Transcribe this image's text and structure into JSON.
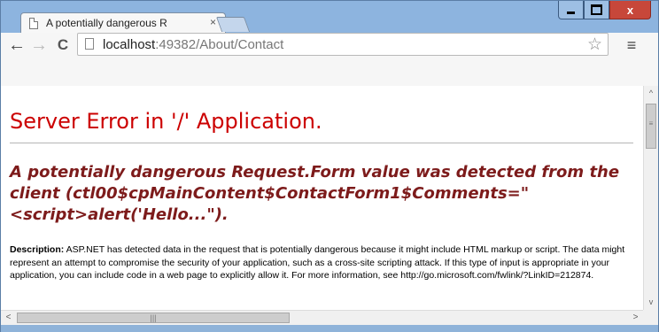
{
  "browser": {
    "tab_title": "A potentially dangerous R",
    "tab_close_glyph": "×",
    "url_host": "localhost",
    "url_rest": ":49382/About/Contact",
    "window_buttons": {
      "minimize": "",
      "maximize": "",
      "close": "x"
    },
    "icons": {
      "back": "←",
      "forward": "→",
      "reload": "C",
      "star": "☆",
      "menu": "≡"
    }
  },
  "page": {
    "heading": "Server Error in '/' Application.",
    "error_message": "A potentially dangerous Request.Form value was detected from the client (ctl00$cpMainContent$ContactForm1$Comments=\"<script>alert('Hello...\").",
    "description_label": "Description:",
    "description_text": " ASP.NET has detected data in the request that is potentially dangerous because it might include HTML markup or script. The data might represent an attempt to compromise the security of your application, such as a cross-site scripting attack. If this type of input is appropriate in your application, you can include code in a web page to explicitly allow it. For more information, see http://go.microsoft.com/fwlink/?LinkID=212874."
  },
  "scrollbars": {
    "up": "^",
    "down": "v",
    "left": "<",
    "right": ">",
    "grip": "|||"
  },
  "colors": {
    "heading": "#cc0000",
    "error_message": "#7d1b1b",
    "frame": "#8fb3d9",
    "close_button": "#c7473a"
  }
}
